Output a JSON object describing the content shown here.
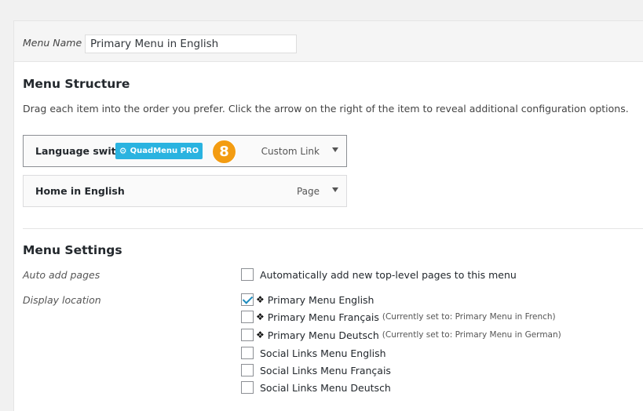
{
  "menu_name": {
    "label": "Menu Name",
    "value": "Primary Menu in English"
  },
  "menu_structure": {
    "title": "Menu Structure",
    "description": "Drag each item into the order you prefer. Click the arrow on the right of the item to reveal additional configuration options.",
    "items": [
      {
        "title": "Language switch",
        "badge": "QuadMenu PRO",
        "step": "8",
        "type": "Custom Link"
      },
      {
        "title": "Home in English",
        "type": "Page"
      }
    ]
  },
  "menu_settings": {
    "title": "Menu Settings",
    "auto_add_label": "Auto add pages",
    "auto_add_option": "Automatically add new top-level pages to this menu",
    "display_location_label": "Display location",
    "locations": [
      {
        "label": "Primary Menu English",
        "checked": true,
        "diamond": "❖",
        "note": ""
      },
      {
        "label": "Primary Menu Français",
        "checked": false,
        "diamond": "❖",
        "note": "(Currently set to: Primary Menu in French)"
      },
      {
        "label": "Primary Menu Deutsch",
        "checked": false,
        "diamond": "❖",
        "note": "(Currently set to: Primary Menu in German)"
      },
      {
        "label": "Social Links Menu English",
        "checked": false,
        "diamond": "",
        "note": ""
      },
      {
        "label": "Social Links Menu Français",
        "checked": false,
        "diamond": "",
        "note": ""
      },
      {
        "label": "Social Links Menu Deutsch",
        "checked": false,
        "diamond": "",
        "note": ""
      }
    ]
  },
  "colors": {
    "badge": "#2ab3e0",
    "step_circle": "#f39c12",
    "checkmark": "#1e8cbe"
  },
  "icons": {
    "badge_icon": "gear-icon",
    "toggle_icon": "caret-down-icon"
  }
}
